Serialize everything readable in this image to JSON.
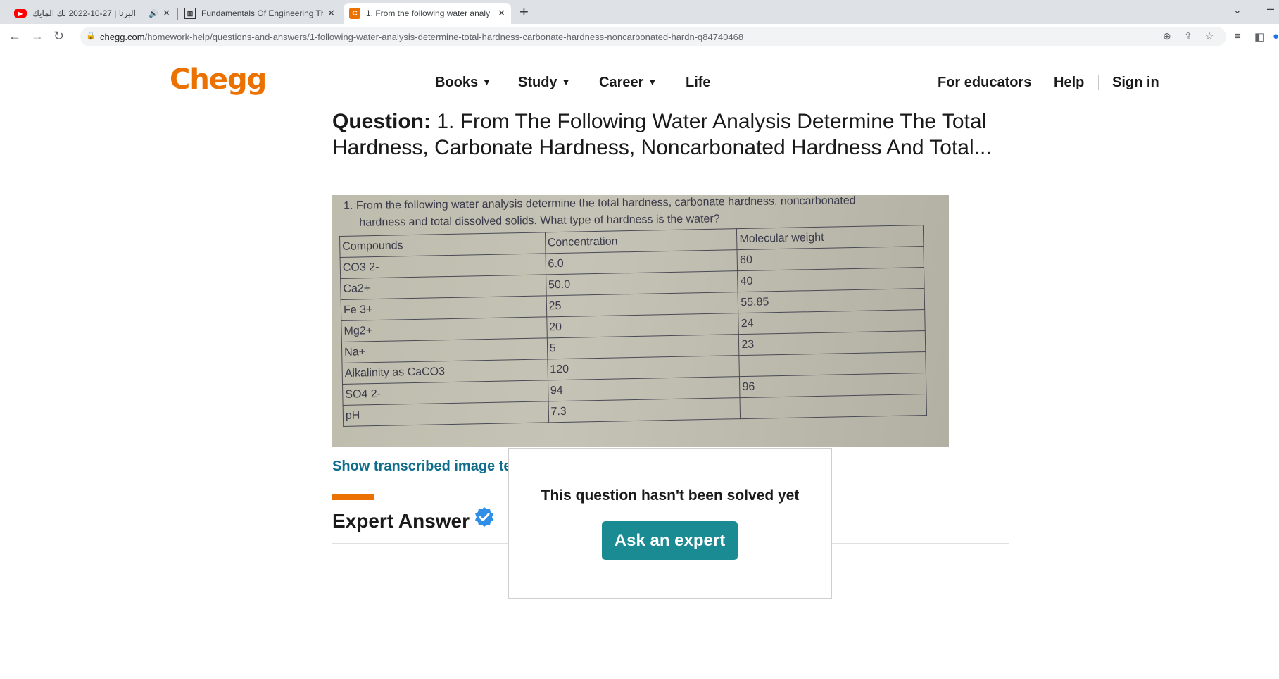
{
  "browser": {
    "tabs": [
      {
        "title": "البرنا | 27-10-2022 لك المايك",
        "favicon": "youtube-icon"
      },
      {
        "title": "Fundamentals Of Engineering Th",
        "favicon": "book-icon"
      },
      {
        "title": "1. From the following water analy",
        "favicon": "chegg-icon"
      }
    ],
    "url_host": "chegg.com",
    "url_path": "/homework-help/questions-and-answers/1-following-water-analysis-determine-total-hardness-carbonate-hardness-noncarbonated-hardn-q84740468"
  },
  "header": {
    "logo": "Chegg",
    "nav": [
      "Books",
      "Study",
      "Career",
      "Life"
    ],
    "right_links": [
      "For educators",
      "Help",
      "Sign in"
    ]
  },
  "question": {
    "label": "Question:",
    "text": "1. From The Following Water Analysis Determine The Total Hardness, Carbonate Hardness, Noncarbonated Hardness And Total..."
  },
  "image": {
    "prompt_line1": "1. From the following water analysis determine the total hardness, carbonate hardness, noncarbonated",
    "prompt_line2": "hardness and total dissolved solids. What type of hardness is the water?",
    "headers": [
      "Compounds",
      "Concentration",
      "Molecular weight"
    ],
    "rows": [
      [
        "CO3 2-",
        "6.0",
        "60"
      ],
      [
        "Ca2+",
        "50.0",
        "40"
      ],
      [
        "Fe 3+",
        "25",
        "55.85"
      ],
      [
        "Mg2+",
        "20",
        "24"
      ],
      [
        "Na+",
        "5",
        "23"
      ],
      [
        "Alkalinity as CaCO3",
        "120",
        ""
      ],
      [
        "SO4 2-",
        "94",
        "96"
      ],
      [
        "pH",
        "7.3",
        ""
      ]
    ]
  },
  "show_transcribed": "Show transcribed image tex",
  "expert_answer": "Expert Answer",
  "modal": {
    "title": "This question hasn't been solved yet",
    "button": "Ask an expert"
  },
  "colors": {
    "brand": "#eb7100",
    "button": "#1b8b93",
    "link": "#0f6e8c"
  }
}
